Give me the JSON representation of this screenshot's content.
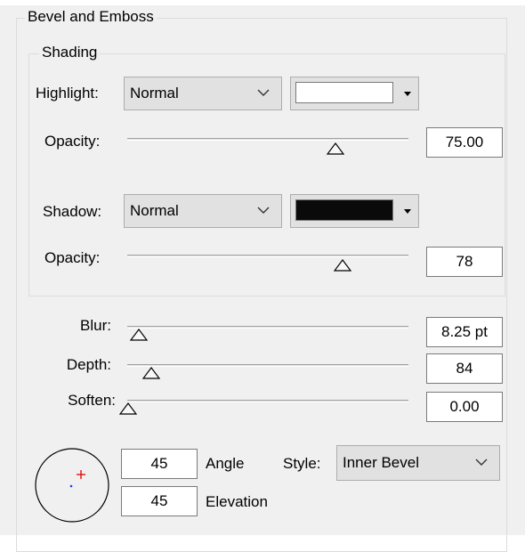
{
  "group_title": "Bevel and Emboss",
  "shading": {
    "title": "Shading",
    "highlight": {
      "label": "Highlight:",
      "mode": "Normal",
      "color": "#ffffff",
      "opacity_label": "Opacity:",
      "opacity": "75.00",
      "slider_fraction": 0.75
    },
    "shadow": {
      "label": "Shadow:",
      "mode": "Normal",
      "color": "#0a0a0a",
      "opacity_label": "Opacity:",
      "opacity": "78",
      "slider_fraction": 0.78
    }
  },
  "blur": {
    "label": "Blur:",
    "value": "8.25 pt",
    "slider_fraction": 0.04
  },
  "depth": {
    "label": "Depth:",
    "value": "84",
    "slider_fraction": 0.08
  },
  "soften": {
    "label": "Soften:",
    "value": "0.00",
    "slider_fraction": 0.0
  },
  "angle": {
    "label": "Angle",
    "value": "45"
  },
  "elevation": {
    "label": "Elevation",
    "value": "45"
  },
  "style": {
    "label": "Style:",
    "value": "Inner Bevel"
  },
  "icons": {
    "dropdown": "chevron-down-icon",
    "color_dropdown": "triangle-down-icon",
    "slider_thumb": "triangle-thumb-icon",
    "light_dial": "light-direction-dial-icon"
  }
}
